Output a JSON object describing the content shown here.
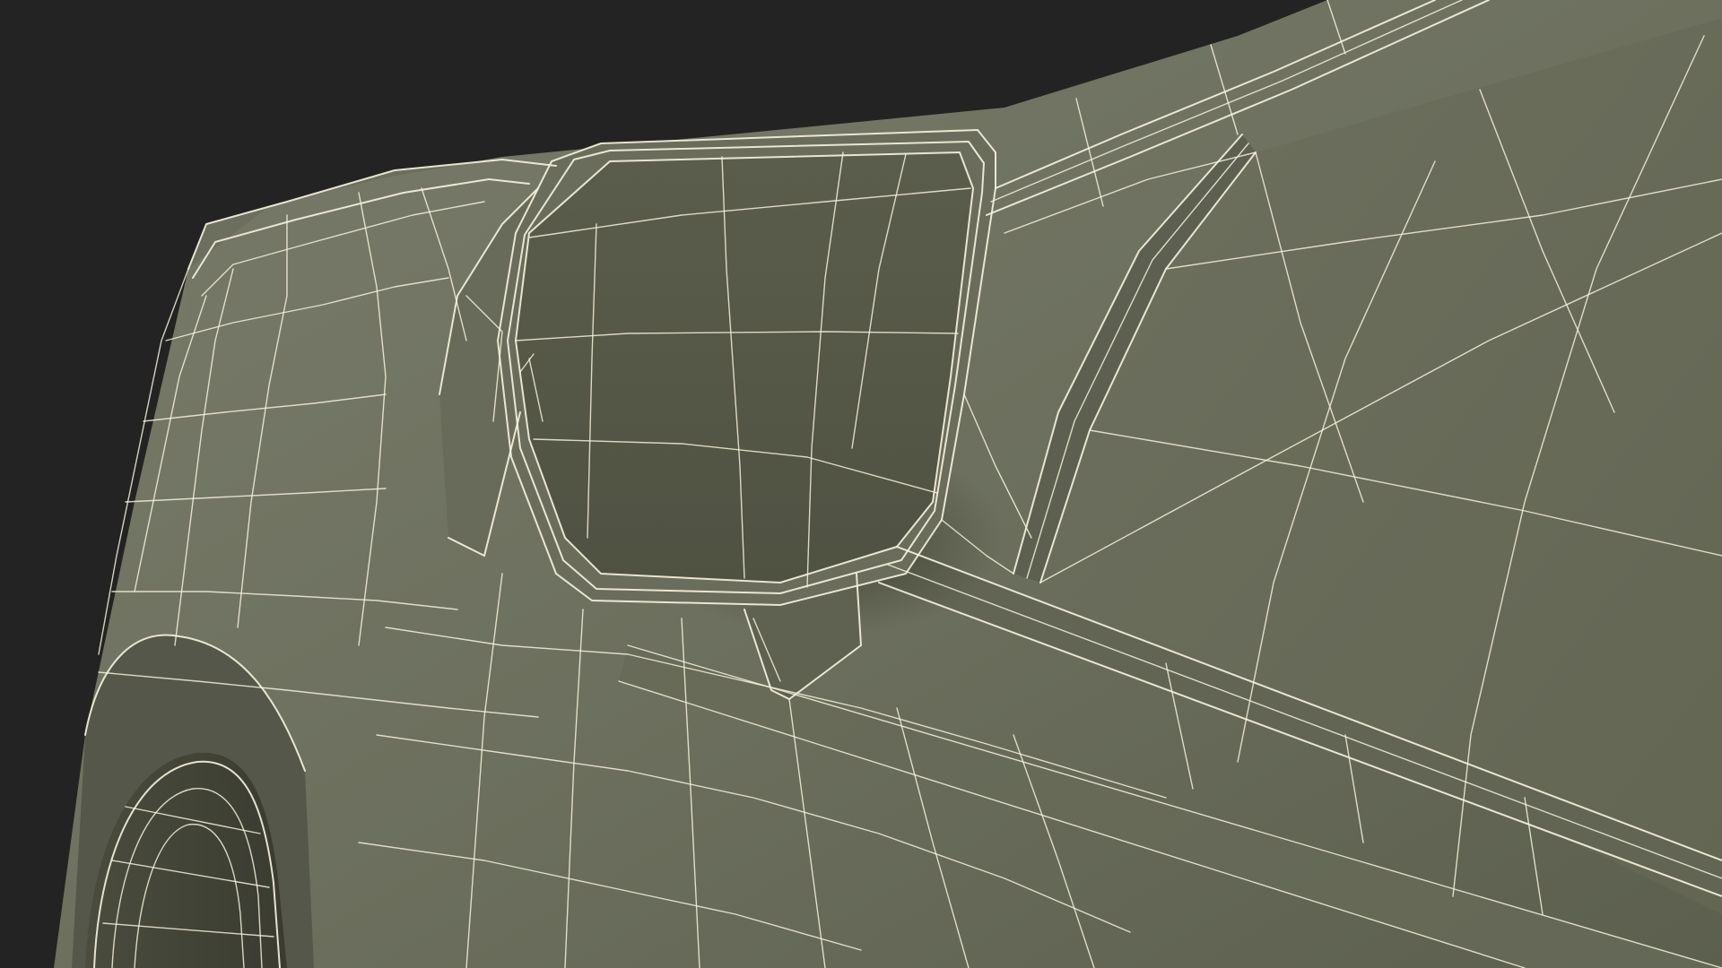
{
  "scene": {
    "background_color": "#232323",
    "surface_color": "#6f7261",
    "surface_dark_color": "#565848",
    "wire_color": "#f4f1dc",
    "subject": "wireframe-car-side-mirror"
  }
}
